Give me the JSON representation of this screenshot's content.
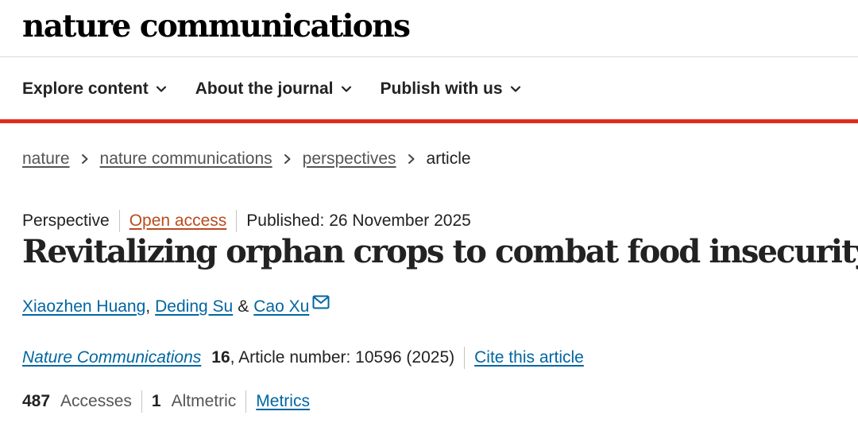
{
  "masthead": "nature communications",
  "nav": {
    "items": [
      {
        "label": "Explore content",
        "icon": "chevron-down-icon"
      },
      {
        "label": "About the journal",
        "icon": "chevron-down-icon"
      },
      {
        "label": "Publish with us",
        "icon": "chevron-down-icon"
      }
    ]
  },
  "breadcrumb": {
    "links": [
      "nature",
      "nature communications",
      "perspectives"
    ],
    "current": "article"
  },
  "meta": {
    "type": "Perspective",
    "access": "Open access",
    "published": "Published: 26 November 2025"
  },
  "article": {
    "title": "Revitalizing orphan crops to combat food insecurity",
    "authors": [
      "Xiaozhen Huang",
      "Deding Su",
      "Cao Xu"
    ],
    "author_separator": ",",
    "author_conjunction": "&",
    "contact_icon": "mail-icon"
  },
  "citation": {
    "journal": "Nature Communications",
    "volume": "16",
    "article_number": ", Article number: 10596 (2025)",
    "cite_label": "Cite this article"
  },
  "metrics": {
    "accesses_value": "487",
    "accesses_label": "Accesses",
    "altmetric_value": "1",
    "altmetric_label": "Altmetric",
    "metrics_link": "Metrics"
  },
  "colors": {
    "accent_red": "#e02c1e",
    "link_blue": "#0066a1",
    "open_access_orange": "#b94c1e",
    "text_dark": "#222222"
  }
}
